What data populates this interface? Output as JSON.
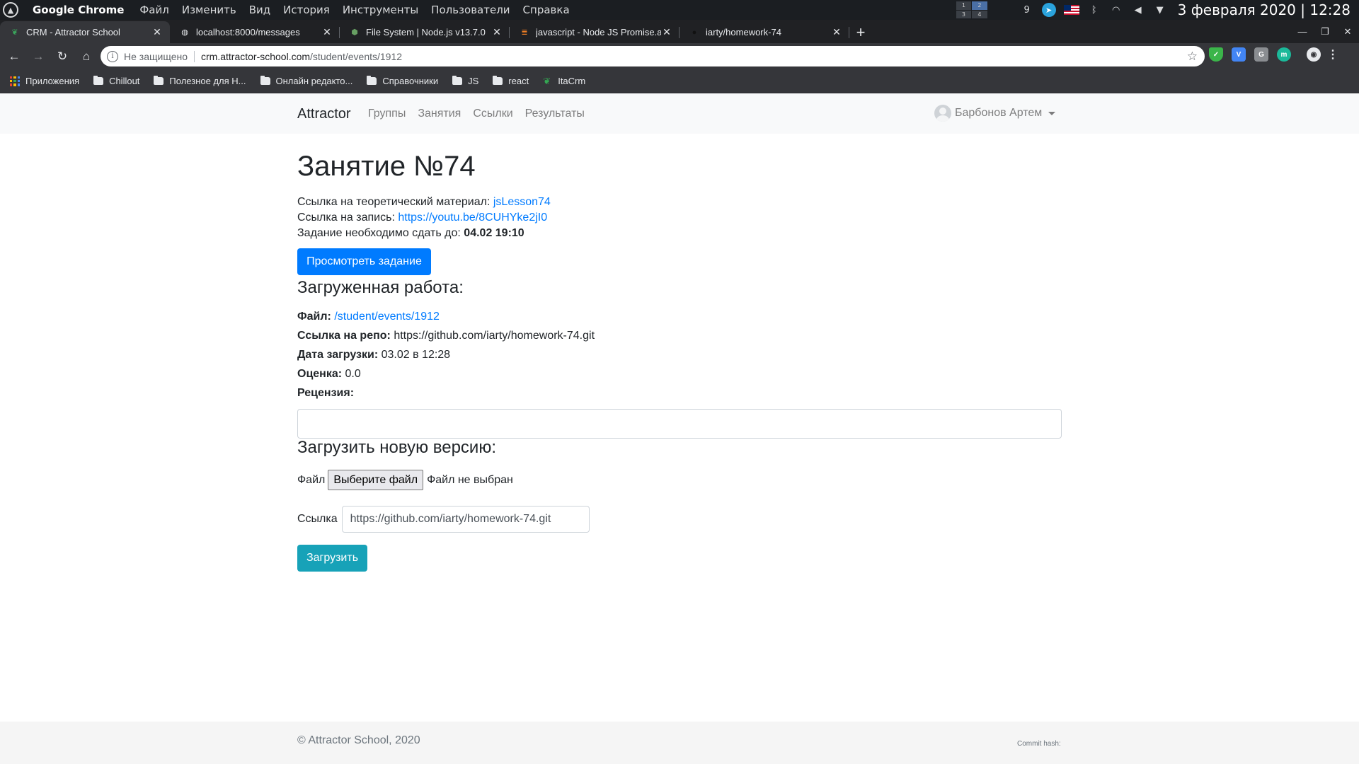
{
  "os": {
    "app_name": "Google Chrome",
    "menu": [
      "Файл",
      "Изменить",
      "Вид",
      "История",
      "Инструменты",
      "Пользователи",
      "Справка"
    ],
    "workspaces": [
      "1",
      "2",
      "3",
      "4"
    ],
    "tray_badge": "9",
    "clock": "3 февраля 2020 | 12:28"
  },
  "tabs": [
    {
      "title": "CRM - Attractor School",
      "icon": "leaf-icon",
      "active": true
    },
    {
      "title": "localhost:8000/messages",
      "icon": "globe-icon",
      "active": false
    },
    {
      "title": "File System | Node.js v13.7.0",
      "icon": "nodejs-icon",
      "active": false
    },
    {
      "title": "javascript - Node JS Promise.a",
      "icon": "stackoverflow-icon",
      "active": false
    },
    {
      "title": "iarty/homework-74",
      "icon": "github-icon",
      "active": false
    }
  ],
  "omnibox": {
    "security": "Не защищено",
    "host": "crm.attractor-school.com",
    "path": "/student/events/1912"
  },
  "bookmarks": [
    {
      "label": "Приложения",
      "icon": "apps-icon"
    },
    {
      "label": "Chillout",
      "icon": "folder-icon"
    },
    {
      "label": "Полезное для Н...",
      "icon": "folder-icon"
    },
    {
      "label": "Онлайн редакто...",
      "icon": "folder-icon"
    },
    {
      "label": "Справочники",
      "icon": "folder-icon"
    },
    {
      "label": "JS",
      "icon": "folder-icon"
    },
    {
      "label": "react",
      "icon": "folder-icon"
    },
    {
      "label": "ItaCrm",
      "icon": "leaf-icon"
    }
  ],
  "site_nav": {
    "brand": "Attractor",
    "links": [
      "Группы",
      "Занятия",
      "Ссылки",
      "Результаты"
    ],
    "user_name": "Барбонов Артем"
  },
  "lesson": {
    "title": "Занятие №74",
    "theory_label": "Ссылка на теоретический материал:",
    "theory_link": "jsLesson74",
    "record_label": "Ссылка на запись:",
    "record_link": "https://youtu.be/8CUHYke2jI0",
    "deadline_label": "Задание необходимо сдать до:",
    "deadline_value": "04.02 19:10",
    "view_task_button": "Просмотреть задание"
  },
  "uploaded": {
    "heading": "Загруженная работа:",
    "file_label": "Файл:",
    "file_value": "/student/events/1912",
    "repo_label": "Ссылка на репо:",
    "repo_value": "https://github.com/iarty/homework-74.git",
    "date_label": "Дата загрузки:",
    "date_value": "03.02 в 12:28",
    "grade_label": "Оценка:",
    "grade_value": "0.0",
    "review_label": "Рецензия:"
  },
  "upload_new": {
    "heading": "Загрузить новую версию:",
    "file_label": "Файл",
    "file_button": "Выберите файл",
    "file_status": "Файл не выбран",
    "link_label": "Ссылка",
    "link_value": "https://github.com/iarty/homework-74.git",
    "submit_button": "Загрузить"
  },
  "footer": {
    "copyright": "© Attractor School, 2020",
    "commit_label": "Commit hash:"
  }
}
